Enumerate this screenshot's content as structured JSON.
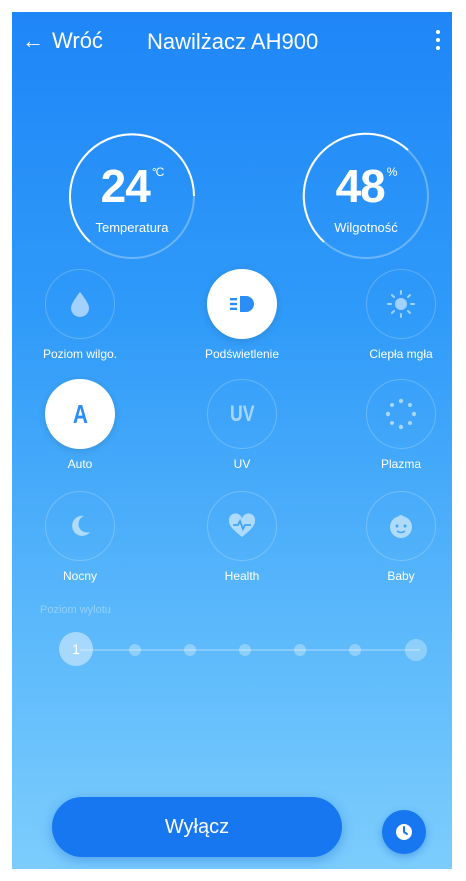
{
  "header": {
    "back_label": "Wróć",
    "title": "Nawilżacz AH900"
  },
  "gauges": {
    "temperature": {
      "value": "24",
      "unit": "°C",
      "label": "Temperatura"
    },
    "humidity": {
      "value": "48",
      "unit": "%",
      "label": "Wilgotność"
    }
  },
  "features": {
    "humidity_level": {
      "label": "Poziom wilgo.",
      "icon": "water-drop-icon",
      "active": false
    },
    "backlight": {
      "label": "Podświetlenie",
      "icon": "headlight-icon",
      "active": true
    },
    "warm_mist": {
      "label": "Ciepła mgła",
      "icon": "sun-icon",
      "active": false
    },
    "auto": {
      "label": "Auto",
      "glyph": "A",
      "icon": "auto-icon",
      "active": true
    },
    "uv": {
      "label": "UV",
      "glyph": "UV",
      "icon": "uv-icon",
      "active": false
    },
    "plasma": {
      "label": "Plazma",
      "icon": "plasma-dots-icon",
      "active": false
    },
    "night": {
      "label": "Nocny",
      "icon": "moon-icon",
      "active": false
    },
    "health": {
      "label": "Health",
      "icon": "heart-pulse-icon",
      "active": false
    },
    "baby": {
      "label": "Baby",
      "icon": "baby-face-icon",
      "active": false
    }
  },
  "fan_slider": {
    "label": "Poziom wylotu",
    "current_value": "1",
    "steps": 7,
    "enabled": false
  },
  "footer": {
    "off_label": "Wyłącz",
    "timer_icon": "clock-icon"
  },
  "colors": {
    "gradient_top": "#1f86f8",
    "gradient_bottom": "#7ccdfd",
    "button_blue": "#1777f1",
    "active_icon_blue": "#2a8df8"
  }
}
